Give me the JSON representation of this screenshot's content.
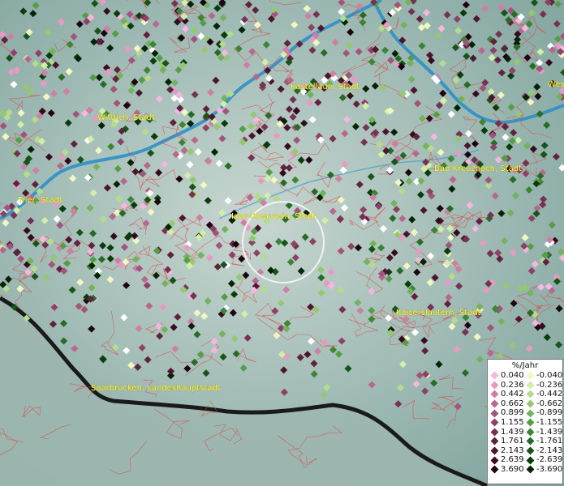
{
  "map": {
    "cities": [
      {
        "name": "Kastellaun, Stadt"
      },
      {
        "name": "Wittlich, Stadt"
      },
      {
        "name": "Bad Kreuznach, Stadt"
      },
      {
        "name": "Trier, Stadt"
      },
      {
        "name": "Idar-Oberstein, Stadt"
      },
      {
        "name": "Kaiserslautern, Stadt"
      },
      {
        "name": "Saarbrücken, Landeshauptstadt"
      },
      {
        "name": "Wes"
      }
    ],
    "colors": {
      "terrain": "#8fb0ab",
      "river": "#2f8fc8",
      "boundary": "#e04040",
      "border": "#1a1a1a",
      "label": "#ffff33"
    }
  },
  "legend": {
    "title": "%/Jahr",
    "positive": [
      {
        "label": "0.040",
        "color": "#f7b6e0"
      },
      {
        "label": "0.236",
        "color": "#e89ac4"
      },
      {
        "label": "0.442",
        "color": "#cf7fa6"
      },
      {
        "label": "0.662",
        "color": "#b8678f"
      },
      {
        "label": "0.899",
        "color": "#a2547b"
      },
      {
        "label": "1.155",
        "color": "#8d4166"
      },
      {
        "label": "1.439",
        "color": "#773152"
      },
      {
        "label": "1.761",
        "color": "#62223f"
      },
      {
        "label": "2.143",
        "color": "#4d162e"
      },
      {
        "label": "2.639",
        "color": "#360b1f"
      },
      {
        "label": "3.690",
        "color": "#1e0310"
      }
    ],
    "negative": [
      {
        "label": "-0.040",
        "color": "#f2f7c2"
      },
      {
        "label": "-0.236",
        "color": "#d4eda8"
      },
      {
        "label": "-0.442",
        "color": "#b4dc8c"
      },
      {
        "label": "-0.662",
        "color": "#94c872"
      },
      {
        "label": "-0.899",
        "color": "#73b35b"
      },
      {
        "label": "-1.155",
        "color": "#559d46"
      },
      {
        "label": "-1.439",
        "color": "#3c8534"
      },
      {
        "label": "-1.761",
        "color": "#276c25"
      },
      {
        "label": "-2.143",
        "color": "#175418"
      },
      {
        "label": "-2.639",
        "color": "#0a3c0c"
      },
      {
        "label": "-3.690",
        "color": "#032405"
      }
    ]
  }
}
